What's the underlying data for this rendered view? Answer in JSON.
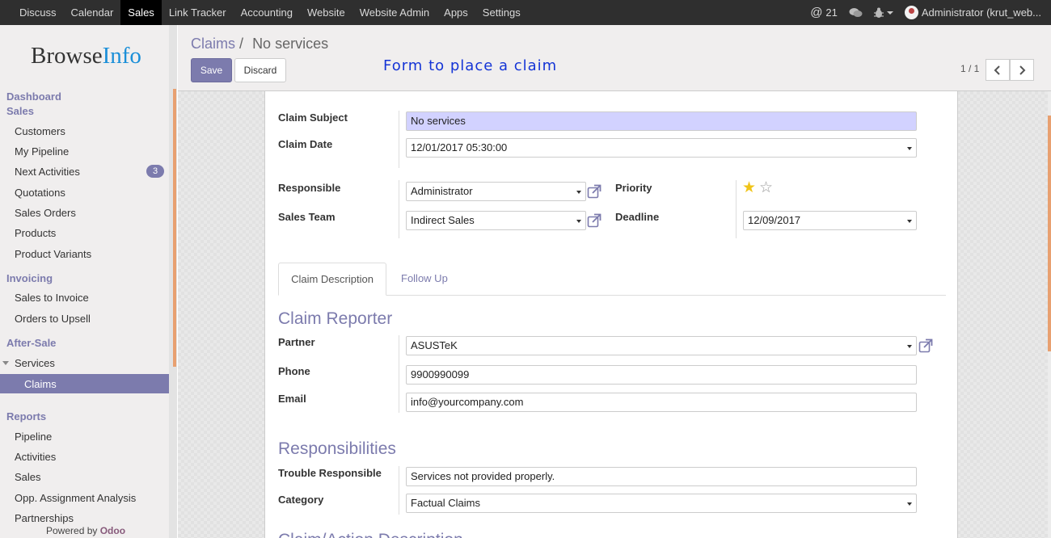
{
  "topbar": {
    "menu": [
      "Discuss",
      "Calendar",
      "Sales",
      "Link Tracker",
      "Accounting",
      "Website",
      "Website Admin",
      "Apps",
      "Settings"
    ],
    "active_menu": "Sales",
    "mentions_count": "21",
    "user": "Administrator (krut_web..."
  },
  "sidebar": {
    "logo_part1": "Browse",
    "logo_part2": "Info",
    "sections": {
      "dashboard": "Dashboard",
      "sales": "Sales",
      "invoicing": "Invoicing",
      "after_sale": "After-Sale",
      "reports": "Reports"
    },
    "sales_items": [
      "Customers",
      "My Pipeline",
      "Next Activities",
      "Quotations",
      "Sales Orders",
      "Products",
      "Product Variants"
    ],
    "next_activities_badge": "3",
    "invoicing_items": [
      "Sales to Invoice",
      "Orders to Upsell"
    ],
    "after_sale_items": [
      "Services"
    ],
    "active_item": "Claims",
    "reports_items": [
      "Pipeline",
      "Activities",
      "Sales",
      "Opp. Assignment Analysis",
      "Partnerships"
    ],
    "powered_by": "Powered by",
    "powered_brand": "Odoo"
  },
  "control_panel": {
    "breadcrumb_parent": "Claims",
    "breadcrumb_sep": "/",
    "breadcrumb_current": "No services",
    "save_label": "Save",
    "discard_label": "Discard",
    "annotation": "Form to place a claim",
    "pager": "1 / 1",
    "prev_icon": "chevron-left-icon",
    "next_icon": "chevron-right-icon"
  },
  "form": {
    "claim_subject_label": "Claim Subject",
    "claim_subject_value": "No services",
    "claim_date_label": "Claim Date",
    "claim_date_value": "12/01/2017 05:30:00",
    "responsible_label": "Responsible",
    "responsible_value": "Administrator",
    "sales_team_label": "Sales Team",
    "sales_team_value": "Indirect Sales",
    "priority_label": "Priority",
    "priority_stars": 1,
    "priority_max": 2,
    "deadline_label": "Deadline",
    "deadline_value": "12/09/2017",
    "tabs": [
      "Claim Description",
      "Follow Up"
    ],
    "active_tab": "Claim Description",
    "claim_reporter_heading": "Claim Reporter",
    "partner_label": "Partner",
    "partner_value": "ASUSTeK",
    "phone_label": "Phone",
    "phone_value": "9900990099",
    "email_label": "Email",
    "email_value": "info@yourcompany.com",
    "responsibilities_heading": "Responsibilities",
    "trouble_label": "Trouble Responsible",
    "trouble_value": "Services not provided properly.",
    "category_label": "Category",
    "category_value": "Factual Claims",
    "next_heading_partial": "Claim/Action Description"
  },
  "colors": {
    "brand": "#7c7bad",
    "topbar": "#2f2f2f",
    "required_field": "#d2d2ff",
    "annotation": "#1434d6",
    "star": "#f0c419"
  }
}
